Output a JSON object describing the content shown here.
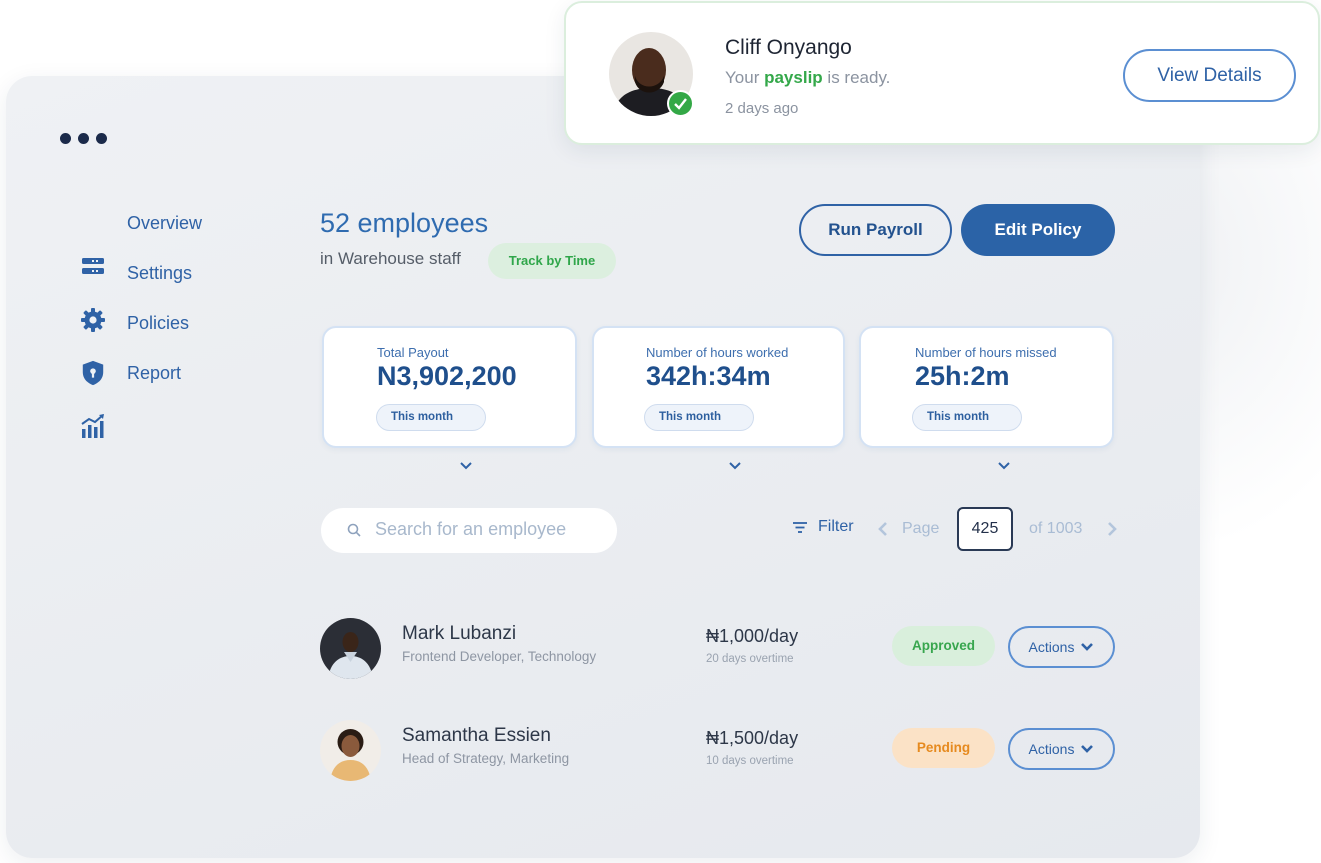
{
  "sidebar": {
    "items": [
      {
        "label": "Overview",
        "icon": "overview"
      },
      {
        "label": "Settings",
        "icon": "settings-bars-icon"
      },
      {
        "label": "Policies",
        "icon": "gear-icon"
      },
      {
        "label": "Report",
        "icon": "shield-icon"
      },
      {
        "label": "",
        "icon": "analytics-chart-icon"
      }
    ]
  },
  "header": {
    "title": "52 employees",
    "subtitle": "in Warehouse staff",
    "badge": "Track by Time",
    "run_payroll": "Run Payroll",
    "edit_policy": "Edit Policy"
  },
  "stats": [
    {
      "label": "Total Payout",
      "value": "N3,902,200",
      "period": "This month"
    },
    {
      "label": "Number of hours worked",
      "value": "342h:34m",
      "period": "This month"
    },
    {
      "label": "Number of hours missed",
      "value": "25h:2m",
      "period": "This month"
    }
  ],
  "toolbar": {
    "search_placeholder": "Search for an employee",
    "filter_label": "Filter",
    "page_label": "Page",
    "page_current": "425",
    "page_total": "of 1003"
  },
  "employees": [
    {
      "name": "Mark Lubanzi",
      "role": "Frontend Developer, Technology",
      "rate": "₦1,000/day",
      "overtime": "20 days overtime",
      "status": "Approved",
      "actions": "Actions"
    },
    {
      "name": "Samantha Essien",
      "role": "Head of Strategy, Marketing",
      "rate": "₦1,500/day",
      "overtime": "10 days overtime",
      "status": "Pending",
      "actions": "Actions"
    }
  ],
  "notification": {
    "name": "Cliff Onyango",
    "msg_prefix": "Your",
    "msg_highlight": "payslip",
    "msg_suffix": "is ready.",
    "time": "2 days ago",
    "button": "View Details"
  },
  "colors": {
    "accent": "#2b63a7",
    "approved": "#38a64e",
    "pending": "#e68a1f",
    "check": "#33a846"
  }
}
